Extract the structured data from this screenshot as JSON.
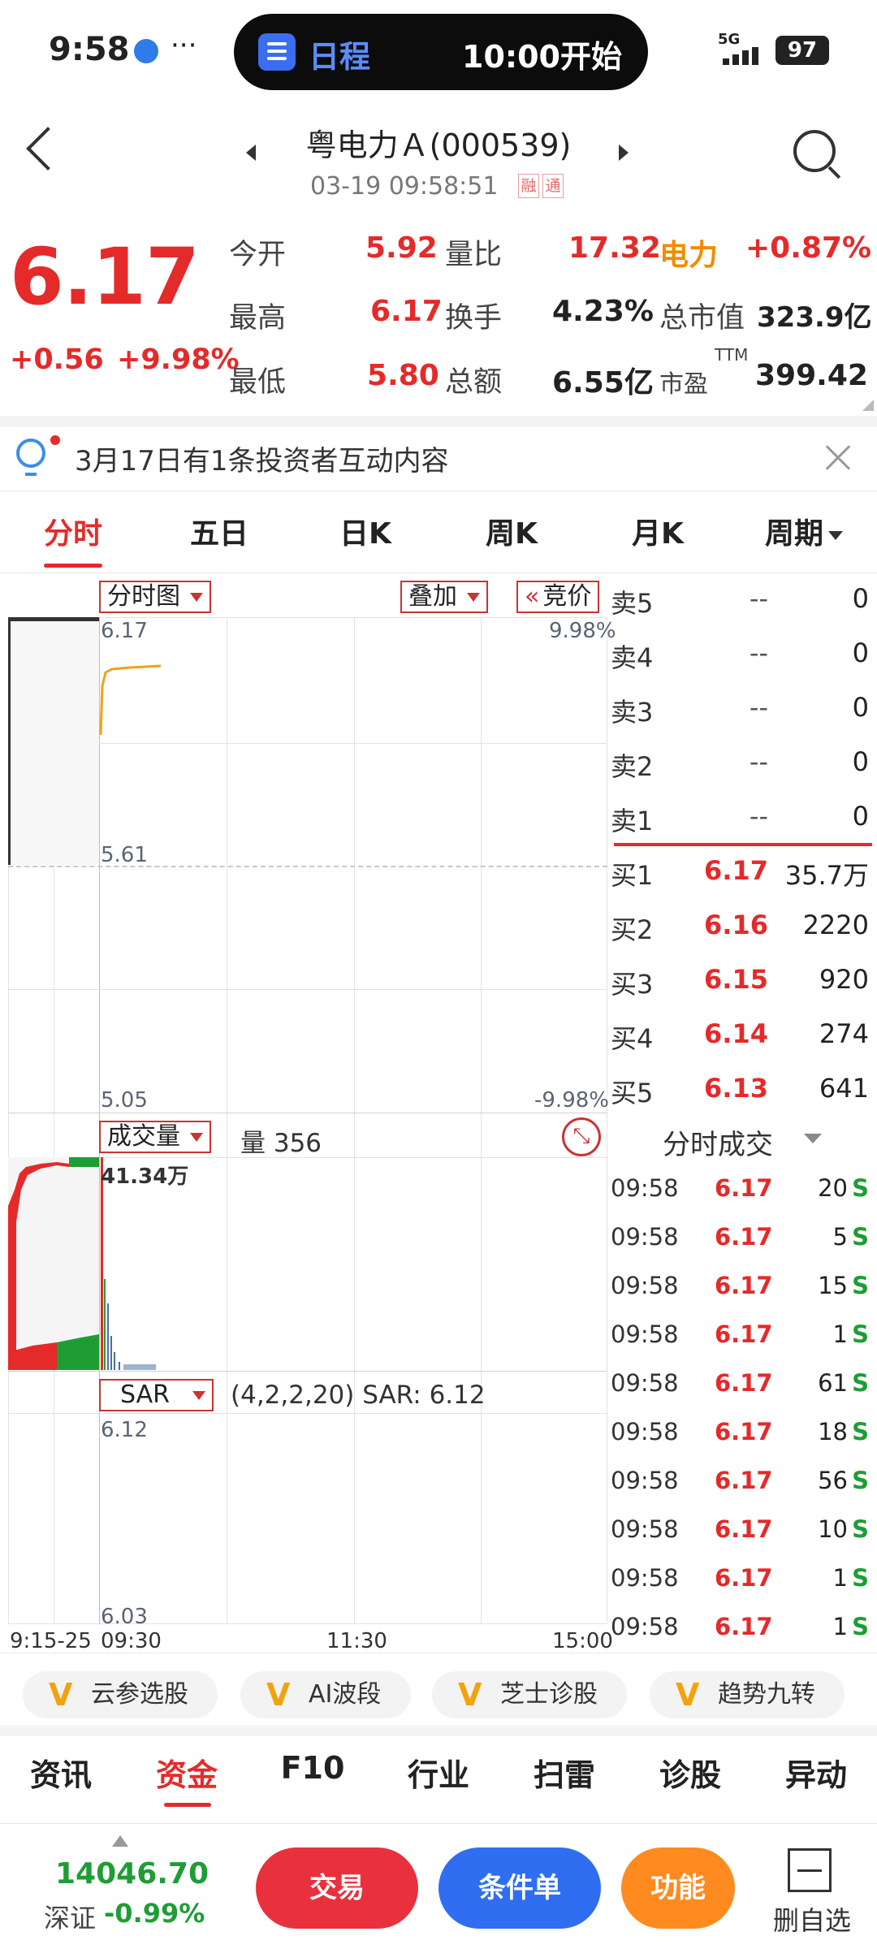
{
  "status_bar": {
    "time": "9:58",
    "dots": "···",
    "pill_label": "日程",
    "pill_event": "10:00开始",
    "network": "5G",
    "battery": "97"
  },
  "header": {
    "title": "粤电力Ａ(000539)",
    "subtitle": "03-19 09:58:51",
    "badge_rong": "融",
    "badge_tong": "通"
  },
  "quote": {
    "price": "6.17",
    "change": "+0.56",
    "change_pct": "+9.98%",
    "rows": [
      {
        "l1": "今开",
        "v1": "5.92",
        "l2": "量比",
        "v2": "17.32",
        "l3": "电力",
        "v3": "+0.87%"
      },
      {
        "l1": "最高",
        "v1": "6.17",
        "l2": "换手",
        "v2": "4.23%",
        "l3": "总市值",
        "v3": "323.9亿"
      },
      {
        "l1": "最低",
        "v1": "5.80",
        "l2": "总额",
        "v2": "6.55亿",
        "l3": "市盈",
        "l3_sup": "TTM",
        "v3": "399.42"
      }
    ]
  },
  "notice": {
    "text": "3月17日有1条投资者互动内容"
  },
  "tabs": [
    "分时",
    "五日",
    "日K",
    "周K",
    "月K",
    "周期"
  ],
  "chart": {
    "type_label": "分时图",
    "overlay_label": "叠加",
    "auction_label": "竞价",
    "price_top": "6.17",
    "price_mid": "5.61",
    "price_bottom": "5.05",
    "pct_top": "9.98%",
    "pct_bottom": "-9.98%",
    "volume_label": "成交量",
    "volume_value": "量 356",
    "volume_max": "41.34万",
    "indicator_label": "SAR",
    "indicator_value": "(4,2,2,20) SAR: 6.12",
    "ind_top": "6.12",
    "ind_bottom": "6.03",
    "x_auction": "9:15-25",
    "x_start": "09:30",
    "x_mid": "11:30",
    "x_end": "15:00"
  },
  "order_book": {
    "asks": [
      {
        "label": "卖5",
        "price": "--",
        "vol": "0"
      },
      {
        "label": "卖4",
        "price": "--",
        "vol": "0"
      },
      {
        "label": "卖3",
        "price": "--",
        "vol": "0"
      },
      {
        "label": "卖2",
        "price": "--",
        "vol": "0"
      },
      {
        "label": "卖1",
        "price": "--",
        "vol": "0"
      }
    ],
    "bids": [
      {
        "label": "买1",
        "price": "6.17",
        "vol": "35.7万"
      },
      {
        "label": "买2",
        "price": "6.16",
        "vol": "2220"
      },
      {
        "label": "买3",
        "price": "6.15",
        "vol": "920"
      },
      {
        "label": "买4",
        "price": "6.14",
        "vol": "274"
      },
      {
        "label": "买5",
        "price": "6.13",
        "vol": "641"
      }
    ]
  },
  "trades": {
    "title": "分时成交",
    "rows": [
      {
        "time": "09:58",
        "price": "6.17",
        "vol": "20",
        "side": "S"
      },
      {
        "time": "09:58",
        "price": "6.17",
        "vol": "5",
        "side": "S"
      },
      {
        "time": "09:58",
        "price": "6.17",
        "vol": "15",
        "side": "S"
      },
      {
        "time": "09:58",
        "price": "6.17",
        "vol": "1",
        "side": "S"
      },
      {
        "time": "09:58",
        "price": "6.17",
        "vol": "61",
        "side": "S"
      },
      {
        "time": "09:58",
        "price": "6.17",
        "vol": "18",
        "side": "S"
      },
      {
        "time": "09:58",
        "price": "6.17",
        "vol": "56",
        "side": "S"
      },
      {
        "time": "09:58",
        "price": "6.17",
        "vol": "10",
        "side": "S"
      },
      {
        "time": "09:58",
        "price": "6.17",
        "vol": "1",
        "side": "S"
      },
      {
        "time": "09:58",
        "price": "6.17",
        "vol": "1",
        "side": "S"
      }
    ]
  },
  "features": [
    "云参选股",
    "AI波段",
    "芝士诊股",
    "趋势九转"
  ],
  "bottom_tabs": [
    "资讯",
    "资金",
    "F10",
    "行业",
    "扫雷",
    "诊股",
    "异动"
  ],
  "footer": {
    "index_value": "14046.70",
    "index_name": "深证",
    "index_change": "-0.99%",
    "btn_trade": "交易",
    "btn_condition": "条件单",
    "btn_function": "功能",
    "btn_remove": "删自选"
  },
  "colors": {
    "up": "#e52a2a",
    "down": "#1f9d35",
    "sector": "#f08c00",
    "accent_blue": "#2f6ef0"
  }
}
